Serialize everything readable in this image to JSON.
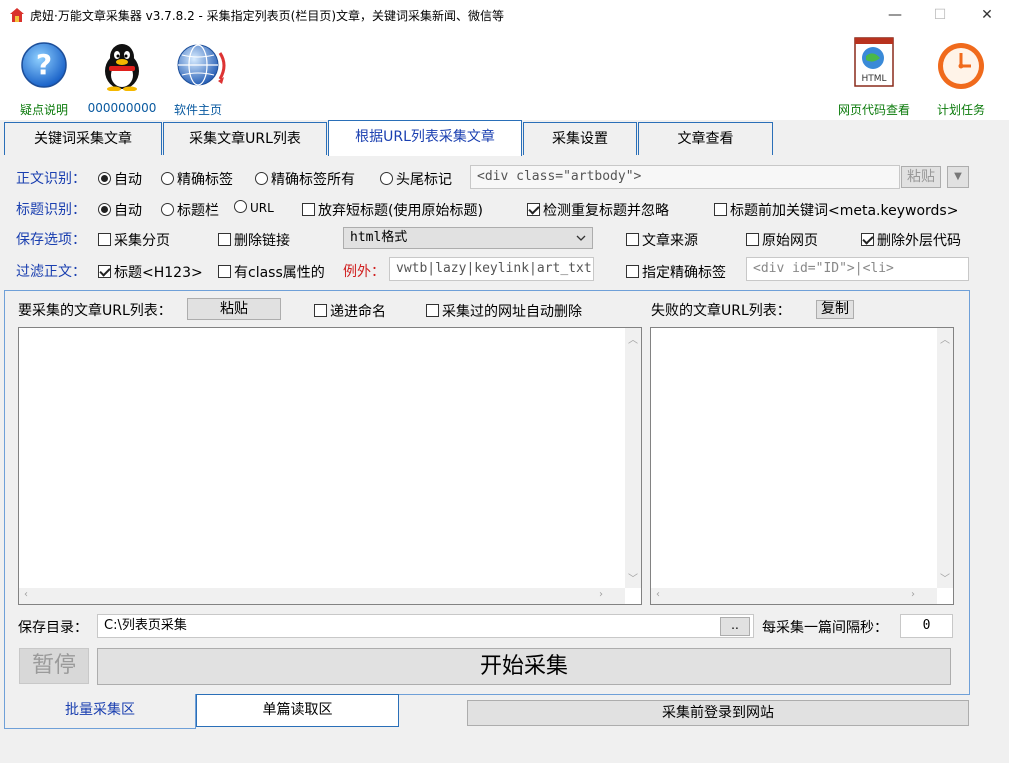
{
  "window": {
    "title": "虎妞·万能文章采集器 v3.7.8.2 - 采集指定列表页(栏目页)文章，关键词采集新闻、微信等",
    "minimize": "—",
    "maximize": "☐",
    "close": "✕"
  },
  "toolbar": {
    "help_label": "疑点说明",
    "qq_label": "000000000",
    "home_label": "软件主页",
    "html_view_label": "网页代码查看",
    "schedule_label": "计划任务",
    "html_icon_text": "HTML"
  },
  "tabs": [
    "关键词采集文章",
    "采集文章URL列表",
    "根据URL列表采集文章",
    "采集设置",
    "文章查看"
  ],
  "body_recog": {
    "label": "正文识别：",
    "opt_auto": "自动",
    "opt_precise": "精确标签",
    "opt_precise_all": "精确标签所有",
    "opt_headtail": "头尾标记",
    "tag_value": "<div class=\"artbody\">",
    "paste": "粘贴",
    "dropdown": "▼"
  },
  "title_recog": {
    "label": "标题识别：",
    "opt_auto": "自动",
    "opt_titlebar": "标题栏",
    "opt_url": "URL",
    "discard_short": "放弃短标题(使用原始标题)",
    "detect_dup": "检测重复标题并忽略",
    "prefix_kw": "标题前加关键词<meta.keywords>"
  },
  "save_opts": {
    "label": "保存选项：",
    "paging": "采集分页",
    "remove_links": "删除链接",
    "format": "html格式",
    "source": "文章来源",
    "original": "原始网页",
    "remove_outer": "删除外层代码"
  },
  "filter": {
    "label": "过滤正文：",
    "title_h123": "标题<H123>",
    "has_class": "有class属性的",
    "exception_label": "例外：",
    "exception_value": "vwtb|lazy|keylink|art_txt",
    "specify_tag": "指定精确标签",
    "specify_value": "<div id=\"ID\">|<li>"
  },
  "url_list": {
    "label": "要采集的文章URL列表：",
    "paste": "粘贴",
    "incremental": "递进命名",
    "auto_delete": "采集过的网址自动删除",
    "failed_label": "失败的文章URL列表：",
    "copy": "复制"
  },
  "save_dir": {
    "label": "保存目录：",
    "value": "C:\\列表页采集",
    "browse": "..",
    "interval_label": "每采集一篇间隔秒：",
    "interval_value": "0"
  },
  "actions": {
    "pause": "暂停",
    "start": "开始采集"
  },
  "bottom_tabs": {
    "batch": "批量采集区",
    "single": "单篇读取区",
    "login": "采集前登录到网站"
  },
  "colors": {
    "accent_blue": "#1a3fb0",
    "tab_border": "#2a6fb8",
    "toolbar_label": "#0a7a0a",
    "exception_red": "#d02020"
  }
}
